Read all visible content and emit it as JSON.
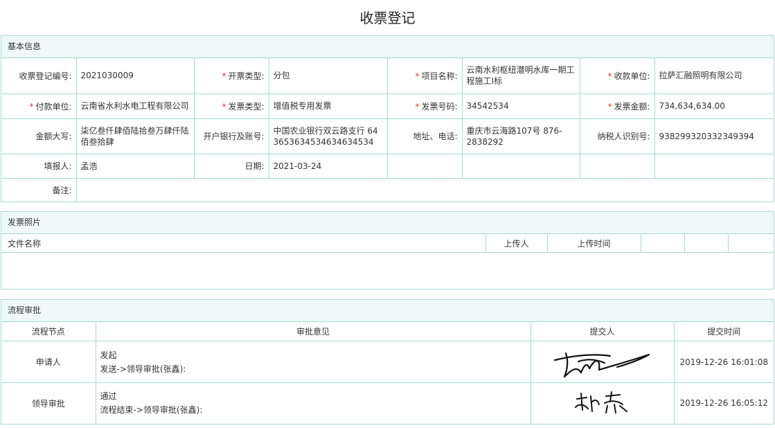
{
  "page_title": "收票登记",
  "basic": {
    "header": "基本信息",
    "row1": {
      "l1": "收票登记编号:",
      "v1": "2021030009",
      "l2": "开票类型:",
      "v2": "分包",
      "l3": "项目名称:",
      "v3": "云南水利枢纽潜明水库一期工程施工I标",
      "l4": "收款单位:",
      "v4": "拉萨汇融照明有限公司"
    },
    "row2": {
      "l1": "付款单位:",
      "v1": "云南省水利水电工程有限公司",
      "l2": "发票类型:",
      "v2": "增值税专用发票",
      "l3": "发票号码:",
      "v3": "34542534",
      "l4": "发票金额:",
      "v4": "734,634,634.00"
    },
    "row3": {
      "l1": "金额大写:",
      "v1": "柒亿叁仟肆佰陆拾叁万肆仟陆佰叁拾肆",
      "l2": "开户银行及账号:",
      "v2": "中国农业银行双云路支行 643653634534634634534",
      "l3": "地址、电话:",
      "v3": "重庆市云海路107号 876-2838292",
      "l4": "纳税人识别号:",
      "v4": "938299320332349394"
    },
    "row4": {
      "l1": "填报人:",
      "v1": "孟浩",
      "l2": "日期:",
      "v2": "2021-03-24"
    },
    "row5": {
      "l1": "备注:",
      "v1": ""
    }
  },
  "invoice_photos": {
    "header": "发票照片",
    "columns": [
      "文件名称",
      "上传人",
      "上传时间"
    ]
  },
  "workflow": {
    "header": "流程审批",
    "columns": [
      "流程节点",
      "审批意见",
      "提交人",
      "提交时间"
    ],
    "rows": [
      {
        "node": "申请人",
        "opinion": "发起",
        "action": "发送->领导审批(张鑫):",
        "time": "2019-12-26 16:01:08"
      },
      {
        "node": "领导审批",
        "opinion": "通过",
        "action": "流程结束->领导审批(张鑫):",
        "time": "2019-12-26 16:05:12"
      }
    ]
  }
}
